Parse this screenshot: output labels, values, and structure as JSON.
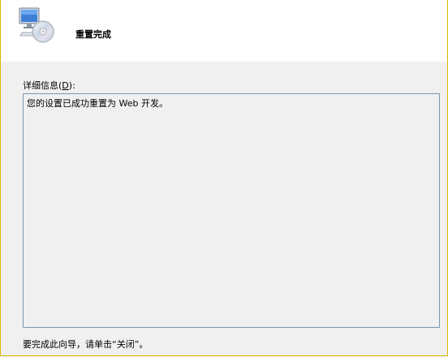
{
  "header": {
    "title": "重置完成",
    "icon": "computer-disc-icon"
  },
  "details": {
    "label_prefix": "详细信息(",
    "label_accel": "D",
    "label_suffix": "):",
    "text": "您的设置已成功重置为 Web 开发。"
  },
  "footer": {
    "instruction": "要完成此向导，请单击“关闭”。"
  },
  "colors": {
    "window_border": "#d9b800",
    "header_background": "#ffffff",
    "body_background": "#f0f0f0",
    "details_border": "#7a96b4"
  }
}
